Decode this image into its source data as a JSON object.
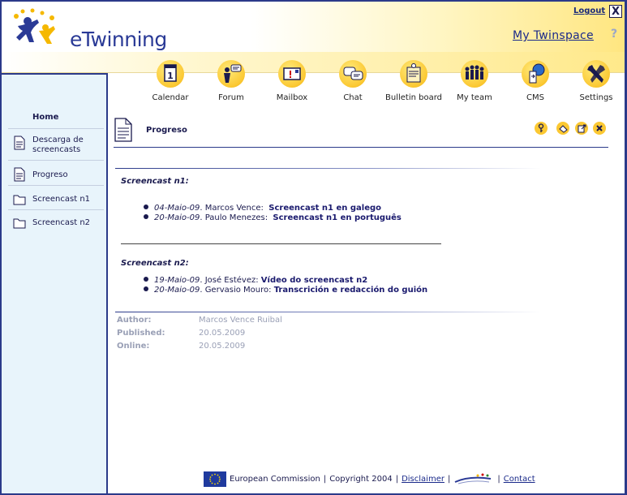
{
  "header": {
    "brand": "eTwinning",
    "logout_label": "Logout",
    "twinspace_label": "My Twinspace",
    "close_glyph": "X",
    "help_glyph": "?"
  },
  "toolbar": {
    "items": [
      {
        "label": "Calendar",
        "icon": "calendar-icon"
      },
      {
        "label": "Forum",
        "icon": "forum-icon"
      },
      {
        "label": "Mailbox",
        "icon": "mailbox-icon"
      },
      {
        "label": "Chat",
        "icon": "chat-icon"
      },
      {
        "label": "Bulletin board",
        "icon": "bulletin-board-icon"
      },
      {
        "label": "My team",
        "icon": "team-icon"
      },
      {
        "label": "CMS",
        "icon": "cms-icon"
      },
      {
        "label": "Settings",
        "icon": "settings-icon"
      }
    ]
  },
  "sidebar": {
    "home": "Home",
    "items": [
      {
        "label": "Descarga de screencasts",
        "icon": "document-icon"
      },
      {
        "label": "Progreso",
        "icon": "document-icon"
      },
      {
        "label": "Screencast n1",
        "icon": "folder-icon"
      },
      {
        "label": "Screencast n2",
        "icon": "folder-icon"
      }
    ]
  },
  "page": {
    "title": "Progreso",
    "actions": [
      "key-icon",
      "edit-icon",
      "export-icon",
      "delete-icon"
    ]
  },
  "content": {
    "section1": {
      "title": "Screencast n1:",
      "rows": [
        {
          "date": "04-Maio-09",
          "person": "Marcos Vence:",
          "link": "Screencast n1 en galego"
        },
        {
          "date": "20-Maio-09",
          "person": "Paulo Menezes:",
          "link": "Screencast n1 en português"
        }
      ]
    },
    "section2": {
      "title": "Screencast n2:",
      "rows": [
        {
          "date": "19-Maio-09",
          "person": "José Estévez:",
          "link": "Vídeo do screencast n2"
        },
        {
          "date": "20-Maio-09",
          "person": "Gervasio Mouro:",
          "link": "Transcrición e redacción do guión"
        }
      ]
    }
  },
  "meta": {
    "author_label": "Author:",
    "author": "Marcos Vence Ruibal",
    "published_label": "Published:",
    "published": "20.05.2009",
    "online_label": "Online:",
    "online": "20.05.2009"
  },
  "footer": {
    "commission": "European Commission",
    "copyright": "Copyright 2004",
    "disclaimer": "Disclaimer",
    "contact": "Contact",
    "pipe": "|"
  },
  "colors": {
    "accent": "#2b3a8a",
    "sidebar_bg": "#e8f4fb",
    "icon_gold": "#fbc832"
  }
}
